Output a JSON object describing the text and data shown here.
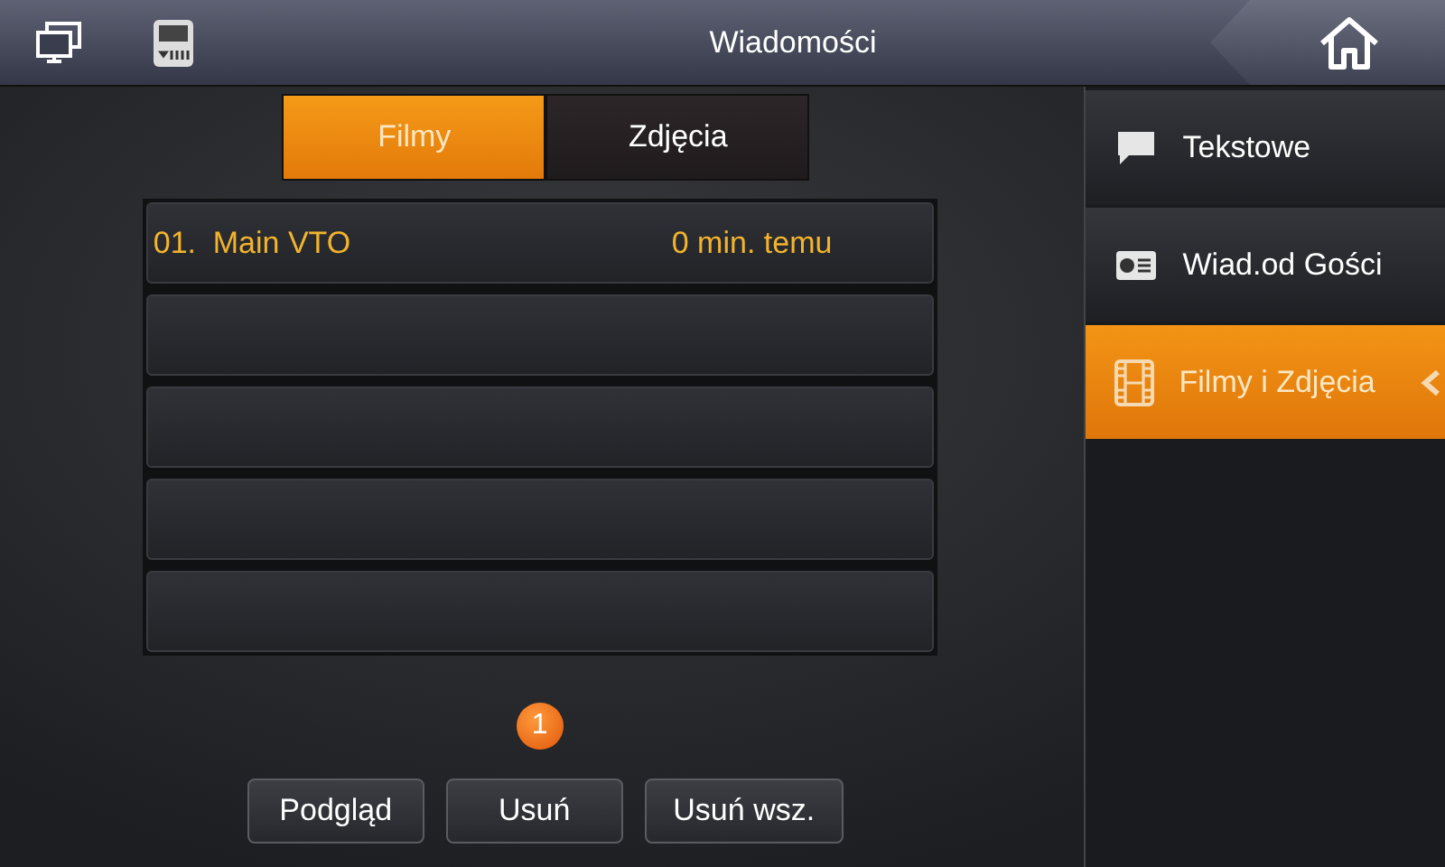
{
  "header": {
    "title": "Wiadomości"
  },
  "tabs": [
    {
      "label": "Filmy",
      "selected": true
    },
    {
      "label": "Zdjęcia",
      "selected": false
    }
  ],
  "records": [
    {
      "number": "01.",
      "name": "Main VTO",
      "time": "0 min. temu"
    }
  ],
  "pages": [
    {
      "label": "1",
      "selected": true
    }
  ],
  "buttons": [
    "Podgląd",
    "Usuń",
    "Usuń wsz."
  ],
  "sidebar": {
    "items": [
      {
        "kind": "text",
        "label": "Tekstowe",
        "selected": false
      },
      {
        "kind": "visitor",
        "label": "Wiad.od Gości",
        "selected": false
      },
      {
        "kind": "media",
        "label": "Filmy i Zdjęcia",
        "selected": true
      }
    ]
  }
}
